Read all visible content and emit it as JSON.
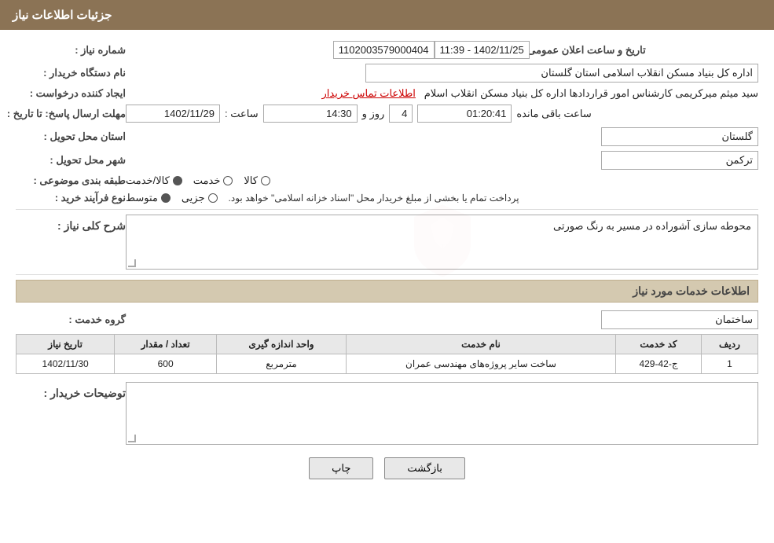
{
  "header": {
    "title": "جزئیات اطلاعات نیاز"
  },
  "fields": {
    "need_number_label": "شماره نیاز :",
    "need_number_value": "1102003579000404",
    "announcement_date_label": "تاریخ و ساعت اعلان عمومی :",
    "announcement_date_value": "1402/11/25 - 11:39",
    "buyer_org_label": "نام دستگاه خریدار :",
    "buyer_org_value": "اداره کل بنیاد مسکن انقلاب اسلامی استان گلستان",
    "requester_label": "ایجاد کننده درخواست :",
    "requester_value": "سید میثم میرکریمی کارشناس امور قراردادها اداره کل بنیاد مسکن انقلاب اسلام",
    "contact_link": "اطلاعات تماس خریدار",
    "response_deadline_label": "مهلت ارسال پاسخ: تا تاریخ :",
    "response_date_value": "1402/11/29",
    "response_time_label": "ساعت :",
    "response_time_value": "14:30",
    "response_days_label": "روز و",
    "response_days_value": "4",
    "response_remaining_label": "ساعت باقی مانده",
    "response_remaining_value": "01:20:41",
    "province_label": "استان محل تحویل :",
    "province_value": "گلستان",
    "city_label": "شهر محل تحویل :",
    "city_value": "ترکمن",
    "category_label": "طبقه بندی موضوعی :",
    "category_options": [
      {
        "label": "کالا",
        "selected": false
      },
      {
        "label": "خدمت",
        "selected": false
      },
      {
        "label": "کالا/خدمت",
        "selected": true
      }
    ],
    "purchase_type_label": "نوع فرآیند خرید :",
    "purchase_type_options": [
      {
        "label": "جزیی",
        "selected": false
      },
      {
        "label": "متوسط",
        "selected": true
      }
    ],
    "purchase_type_note": "پرداخت تمام یا بخشی از مبلغ خریدار محل \"اسناد خزانه اسلامی\" خواهد بود.",
    "general_description_label": "شرح کلی نیاز :",
    "general_description_value": "محوطه سازی آشوراده در مسیر به رنگ صورتی",
    "services_section_title": "اطلاعات خدمات مورد نیاز",
    "service_group_label": "گروه خدمت :",
    "service_group_value": "ساختمان",
    "services_table": {
      "headers": [
        "ردیف",
        "کد خدمت",
        "نام خدمت",
        "واحد اندازه گیری",
        "تعداد / مقدار",
        "تاریخ نیاز"
      ],
      "rows": [
        {
          "row": "1",
          "code": "ج-42-429",
          "name": "ساخت سایر پروژه‌های مهندسی عمران",
          "unit": "مترمربع",
          "quantity": "600",
          "date": "1402/11/30"
        }
      ]
    },
    "buyer_description_label": "توضیحات خریدار :",
    "buyer_description_value": ""
  },
  "buttons": {
    "print_label": "چاپ",
    "back_label": "بازگشت"
  }
}
